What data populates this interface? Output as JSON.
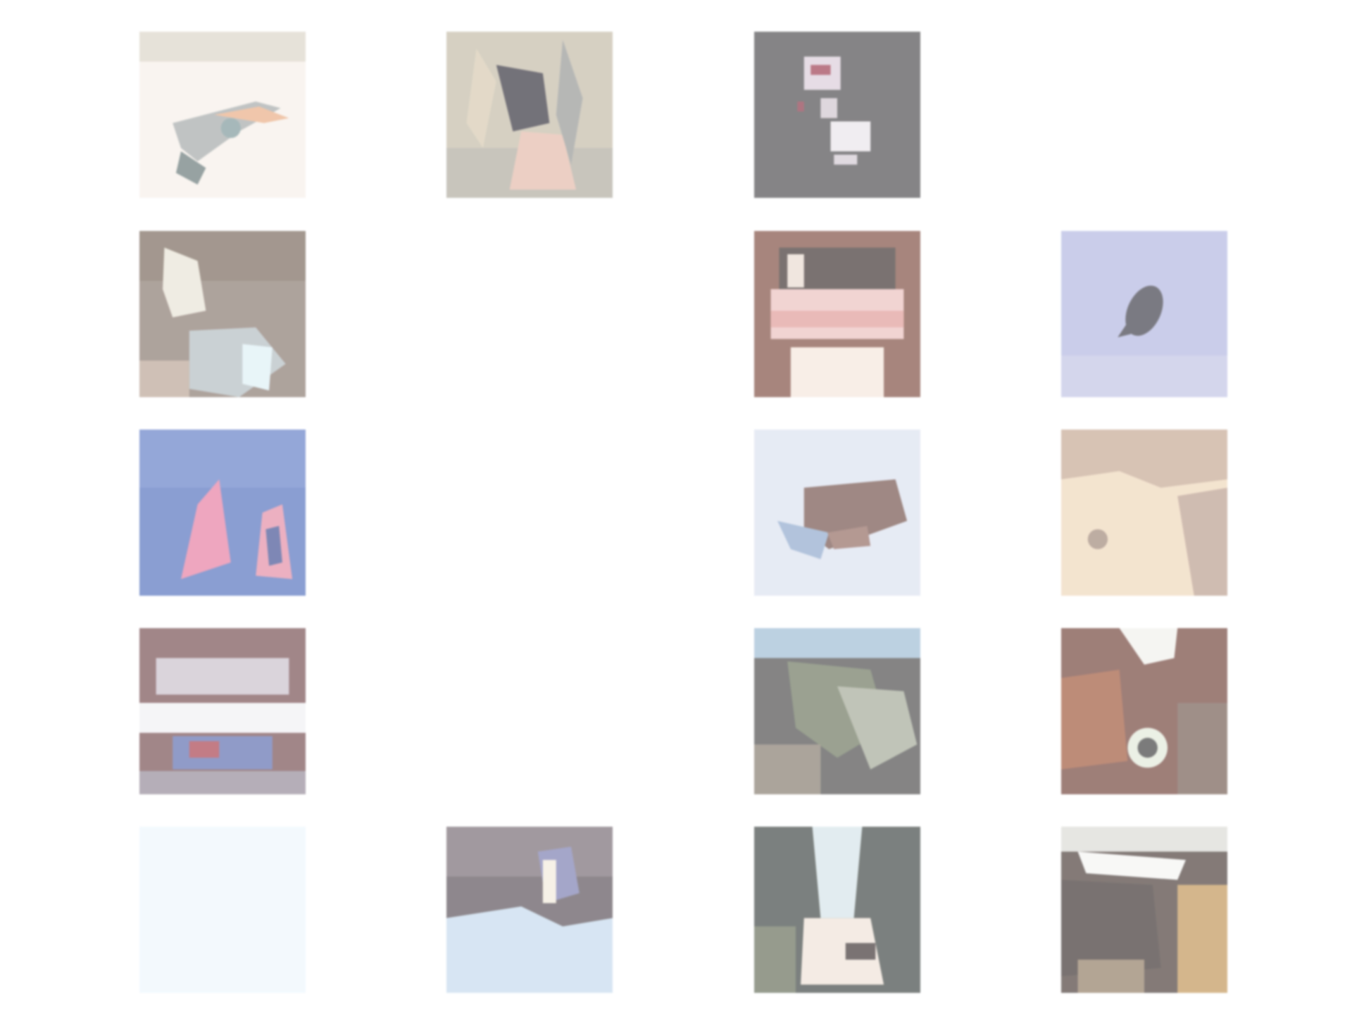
{
  "grid": {
    "rows": 5,
    "cols": 4,
    "tiles": [
      {
        "row": 1,
        "col": 1,
        "present": true
      },
      {
        "row": 1,
        "col": 2,
        "present": true
      },
      {
        "row": 1,
        "col": 3,
        "present": true
      },
      {
        "row": 1,
        "col": 4,
        "present": false
      },
      {
        "row": 2,
        "col": 1,
        "present": true
      },
      {
        "row": 2,
        "col": 2,
        "present": false
      },
      {
        "row": 2,
        "col": 3,
        "present": true
      },
      {
        "row": 2,
        "col": 4,
        "present": true
      },
      {
        "row": 3,
        "col": 1,
        "present": true
      },
      {
        "row": 3,
        "col": 2,
        "present": false
      },
      {
        "row": 3,
        "col": 3,
        "present": true
      },
      {
        "row": 3,
        "col": 4,
        "present": true
      },
      {
        "row": 4,
        "col": 1,
        "present": true
      },
      {
        "row": 4,
        "col": 2,
        "present": false
      },
      {
        "row": 4,
        "col": 3,
        "present": true
      },
      {
        "row": 4,
        "col": 4,
        "present": true
      },
      {
        "row": 5,
        "col": 1,
        "present": true
      },
      {
        "row": 5,
        "col": 2,
        "present": true
      },
      {
        "row": 5,
        "col": 3,
        "present": true
      },
      {
        "row": 5,
        "col": 4,
        "present": true
      }
    ]
  }
}
